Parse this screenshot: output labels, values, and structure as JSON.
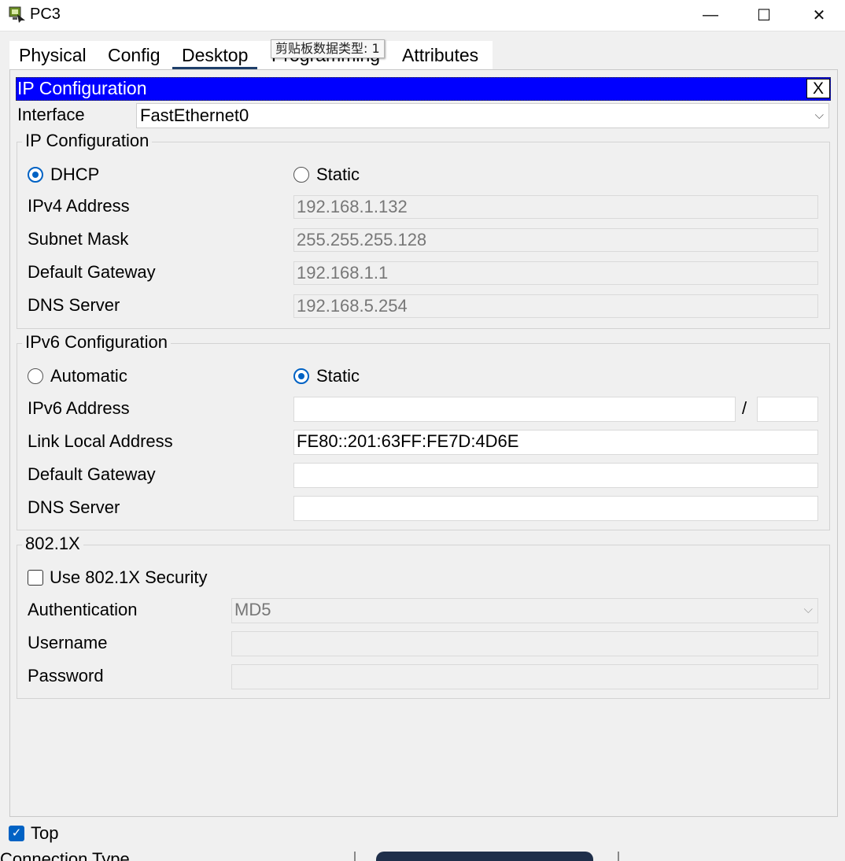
{
  "window": {
    "title": "PC3",
    "minimize_glyph": "—",
    "maximize_glyph": "☐",
    "close_glyph": "✕"
  },
  "tabs": [
    "Physical",
    "Config",
    "Desktop",
    "Programming",
    "Attributes"
  ],
  "active_tab": "Desktop",
  "tooltip": "剪贴板数据类型: 1",
  "ip_config": {
    "title": "IP Configuration",
    "close_label": "X",
    "interface_label": "Interface",
    "interface_value": "FastEthernet0"
  },
  "ipv4": {
    "legend": "IP Configuration",
    "dhcp_label": "DHCP",
    "static_label": "Static",
    "selected_mode": "DHCP",
    "address_label": "IPv4 Address",
    "address_value": "192.168.1.132",
    "mask_label": "Subnet Mask",
    "mask_value": "255.255.255.128",
    "gateway_label": "Default Gateway",
    "gateway_value": "192.168.1.1",
    "dns_label": "DNS Server",
    "dns_value": "192.168.5.254"
  },
  "ipv6": {
    "legend": "IPv6 Configuration",
    "auto_label": "Automatic",
    "static_label": "Static",
    "selected_mode": "Static",
    "address_label": "IPv6 Address",
    "address_value": "",
    "prefix_separator": "/",
    "prefix_value": "",
    "link_local_label": "Link Local Address",
    "link_local_value": "FE80::201:63FF:FE7D:4D6E",
    "gateway_label": "Default Gateway",
    "gateway_value": "",
    "dns_label": "DNS Server",
    "dns_value": ""
  },
  "dot1x": {
    "legend": "802.1X",
    "use_label": "Use 802.1X Security",
    "use_checked": false,
    "auth_label": "Authentication",
    "auth_value": "MD5",
    "username_label": "Username",
    "username_value": "",
    "password_label": "Password",
    "password_value": ""
  },
  "footer": {
    "top_label": "Top",
    "top_checked": true,
    "partial_text": "Connection Type"
  },
  "colors": {
    "title_bar_blue": "#0000ff",
    "radio_accent": "#0062c4",
    "active_tab_underline": "#1e3f6a"
  }
}
